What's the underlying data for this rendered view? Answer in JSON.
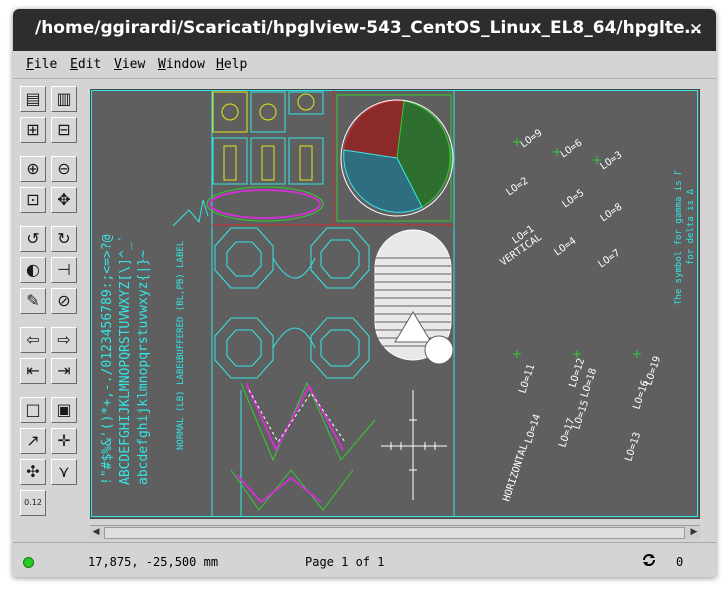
{
  "window": {
    "title": "/home/ggirardi/Scaricati/hpglview-543_CentOS_Linux_EL8_64/hpglte…",
    "close_glyph": "✕"
  },
  "menu": [
    {
      "label": "File",
      "key": "F"
    },
    {
      "label": "Edit",
      "key": "E"
    },
    {
      "label": "View",
      "key": "V"
    },
    {
      "label": "Window",
      "key": "W"
    },
    {
      "label": "Help",
      "key": "H"
    }
  ],
  "toolbar": {
    "buttons": [
      "new-file-icon",
      "open-file-icon",
      "add-page-icon",
      "remove-page-icon",
      "zoom-in-icon",
      "zoom-out-icon",
      "zoom-fit-icon",
      "zoom-window-icon",
      "rotate-left-icon",
      "rotate-right-icon",
      "contrast-icon",
      "split-icon",
      "pen-settings-icon",
      "no-fill-icon",
      "undo-icon",
      "redo-icon",
      "first-page-icon",
      "next-page-icon",
      "rectangle-icon",
      "filled-rectangle-icon",
      "arrow-line-icon",
      "crosshair-icon",
      "pan-icon",
      "polyline-icon",
      "measure-icon"
    ],
    "measure_label": "0.12"
  },
  "drawing": {
    "char_rows": [
      "!\"#$%&'()*+,-./0123456789:;<=>?@",
      "ABCDEFGHIJKLMNOPQRSTUVWXYZ[\\]^_`",
      "abcdefghijklmnopqrstuvwxyz{|}~"
    ],
    "normal_label": "NORMAL (LB)  LABEL",
    "buffered_label": "BUFFERED (BL,PB)  LABEL",
    "lo_labels": [
      "LO=9",
      "LO=6",
      "LO=3",
      "LO=2",
      "LO=5",
      "LO=8",
      "LO=1",
      "LO=4",
      "LO=7",
      "VERTICAL",
      "HORIZONTAL",
      "LO=11",
      "LO=14",
      "LO=17",
      "LO=12",
      "LO=15",
      "LO=18",
      "LO=13",
      "LO=16",
      "LO=19"
    ],
    "symbol_line1": "The symbol for gamma is Γ",
    "symbol_line2": "for delta is Δ"
  },
  "status": {
    "coords": "17,875, -25,500 mm",
    "page": "Page 1 of 1",
    "count": "0"
  },
  "colors": {
    "canvas_bg": "#5f5f5f",
    "cyan": "#33e6e6",
    "yellow": "#e6e61a",
    "red": "#cc2b2b",
    "green": "#33cc33",
    "magenta": "#cc33cc",
    "white": "#ffffff"
  }
}
